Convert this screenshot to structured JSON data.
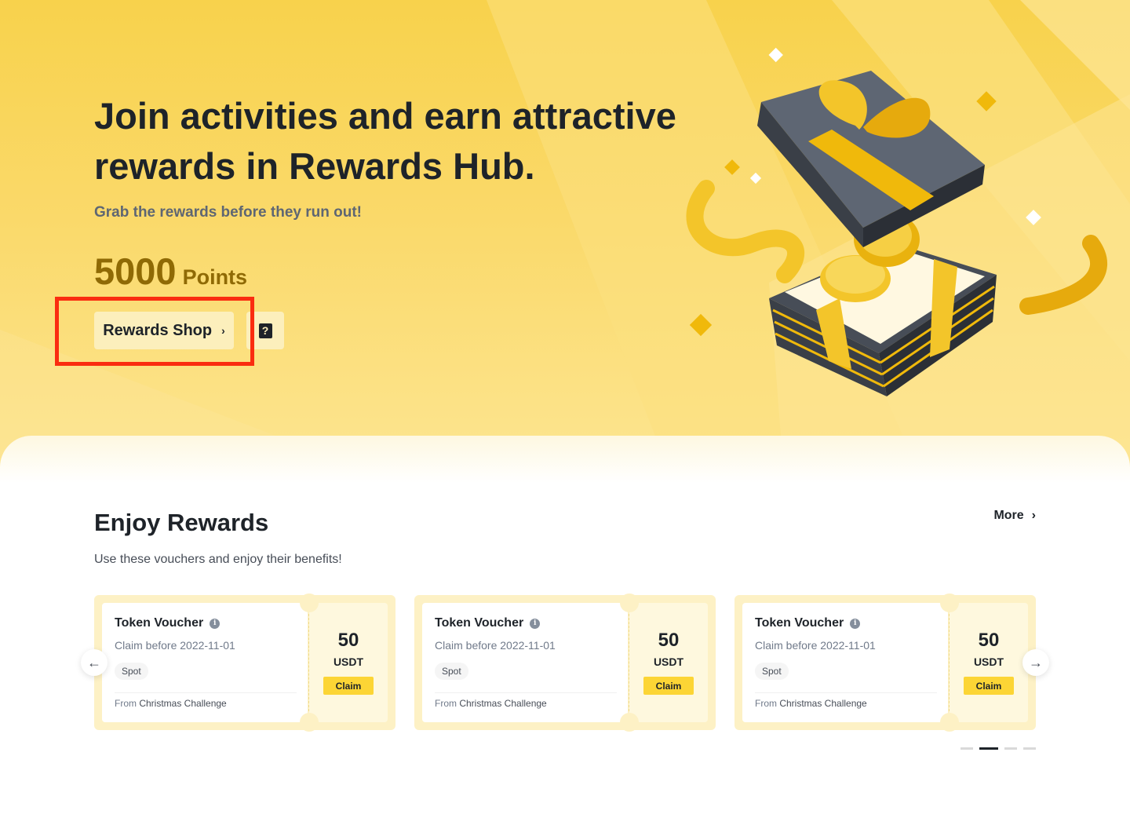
{
  "hero": {
    "title": "Join activities and earn attractive rewards in Rewards Hub.",
    "subtitle": "Grab the rewards before they run out!",
    "points_value": "5000",
    "points_unit": "Points",
    "shop_button": "Rewards Shop",
    "shop_chevron": "›",
    "help_glyph": "?"
  },
  "rewards": {
    "title": "Enjoy Rewards",
    "subtitle": "Use these vouchers and enjoy their benefits!",
    "more_label": "More",
    "more_chevron": "›",
    "vouchers": [
      {
        "title": "Token Voucher",
        "expiry": "Claim before 2022-11-01",
        "tag": "Spot",
        "from_label": "From",
        "from_source": "Christmas Challenge",
        "amount": "50",
        "unit": "USDT",
        "claim": "Claim"
      },
      {
        "title": "Token Voucher",
        "expiry": "Claim before 2022-11-01",
        "tag": "Spot",
        "from_label": "From",
        "from_source": "Christmas Challenge",
        "amount": "50",
        "unit": "USDT",
        "claim": "Claim"
      },
      {
        "title": "Token Voucher",
        "expiry": "Claim before 2022-11-01",
        "tag": "Spot",
        "from_label": "From",
        "from_source": "Christmas Challenge",
        "amount": "50",
        "unit": "USDT",
        "claim": "Claim"
      }
    ],
    "prev_arrow": "←",
    "next_arrow": "→",
    "carousel_pages": 4,
    "carousel_active_index": 1
  },
  "icons": {
    "info": "info-icon",
    "help": "help-book-icon",
    "gift": "gift-box-illustration"
  },
  "colors": {
    "accent": "#fcd535",
    "hero_bg": "#f8d24c",
    "points_text": "#8f6a05",
    "highlight": "#fa2c10",
    "text_primary": "#1e2329"
  }
}
